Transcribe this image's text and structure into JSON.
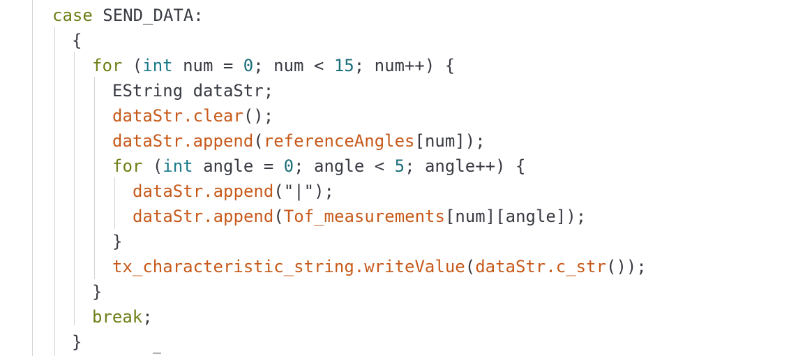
{
  "code_lines": [
    {
      "id": "l1",
      "tokens": [
        {
          "t": "case",
          "c": "kw-green"
        },
        {
          "t": " SEND_DATA:",
          "c": "plain"
        }
      ]
    },
    {
      "id": "l2",
      "tokens": [
        {
          "t": "{",
          "c": "plain"
        }
      ]
    },
    {
      "id": "l3",
      "tokens": [
        {
          "t": "for",
          "c": "kw-green"
        },
        {
          "t": " (",
          "c": "plain"
        },
        {
          "t": "int",
          "c": "kw-blue"
        },
        {
          "t": " num = ",
          "c": "plain"
        },
        {
          "t": "0",
          "c": "num"
        },
        {
          "t": "; num < ",
          "c": "plain"
        },
        {
          "t": "15",
          "c": "num"
        },
        {
          "t": "; num++) {",
          "c": "plain"
        }
      ]
    },
    {
      "id": "l4",
      "tokens": [
        {
          "t": "EString dataStr;",
          "c": "plain"
        }
      ]
    },
    {
      "id": "l5",
      "tokens": [
        {
          "t": "dataStr.clear",
          "c": "fn"
        },
        {
          "t": "();",
          "c": "plain"
        }
      ]
    },
    {
      "id": "l6",
      "tokens": [
        {
          "t": "dataStr.append",
          "c": "fn"
        },
        {
          "t": "(",
          "c": "plain"
        },
        {
          "t": "referenceAngles",
          "c": "fn"
        },
        {
          "t": "[num]);",
          "c": "plain"
        }
      ]
    },
    {
      "id": "l7",
      "tokens": [
        {
          "t": "for",
          "c": "kw-green"
        },
        {
          "t": " (",
          "c": "plain"
        },
        {
          "t": "int",
          "c": "kw-blue"
        },
        {
          "t": " angle = ",
          "c": "plain"
        },
        {
          "t": "0",
          "c": "num"
        },
        {
          "t": "; angle < ",
          "c": "plain"
        },
        {
          "t": "5",
          "c": "num"
        },
        {
          "t": "; angle++) {",
          "c": "plain"
        }
      ]
    },
    {
      "id": "l8",
      "tokens": [
        {
          "t": "dataStr.append",
          "c": "fn"
        },
        {
          "t": "(\"|\");",
          "c": "plain"
        }
      ]
    },
    {
      "id": "l9",
      "tokens": [
        {
          "t": "dataStr.append",
          "c": "fn"
        },
        {
          "t": "(",
          "c": "plain"
        },
        {
          "t": "Tof_measurements",
          "c": "fn"
        },
        {
          "t": "[num][angle]);",
          "c": "plain"
        }
      ]
    },
    {
      "id": "l10",
      "tokens": [
        {
          "t": "}",
          "c": "plain"
        }
      ]
    },
    {
      "id": "l11",
      "tokens": [
        {
          "t": "tx_characteristic_string.writeValue",
          "c": "fn"
        },
        {
          "t": "(",
          "c": "plain"
        },
        {
          "t": "dataStr.c_str",
          "c": "fn"
        },
        {
          "t": "());",
          "c": "plain"
        }
      ]
    },
    {
      "id": "l12",
      "tokens": [
        {
          "t": "}",
          "c": "plain"
        }
      ]
    },
    {
      "id": "l13",
      "tokens": [
        {
          "t": "break",
          "c": "kw-green"
        },
        {
          "t": ";",
          "c": "plain"
        }
      ]
    },
    {
      "id": "l14",
      "tokens": [
        {
          "t": "}",
          "c": "plain"
        }
      ]
    }
  ]
}
